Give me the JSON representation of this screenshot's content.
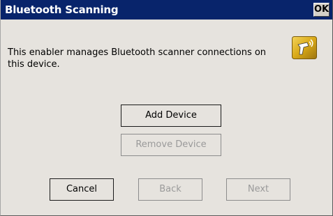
{
  "window": {
    "title": "Bluetooth Scanning",
    "ok_label": "OK"
  },
  "main": {
    "description": "This enabler manages Bluetooth scanner connections on this device.",
    "icon": "bluetooth-scanner-icon",
    "add_device_label": "Add Device",
    "remove_device_label": "Remove Device"
  },
  "footer": {
    "cancel_label": "Cancel",
    "back_label": "Back",
    "next_label": "Next"
  },
  "colors": {
    "titlebar": "#08246b",
    "window_bg": "#e6e3de",
    "icon_gold": "#d4a51a"
  }
}
